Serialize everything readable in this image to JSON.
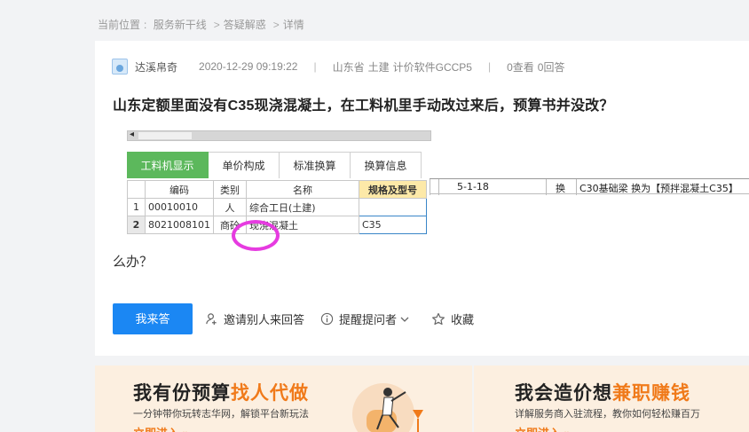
{
  "breadcrumb": {
    "label": "当前位置",
    "colon": ":",
    "items": [
      "服务新干线",
      "答疑解惑",
      "详情"
    ],
    "separator": ">"
  },
  "question": {
    "author": "达溪帛奇",
    "date": "2020-12-29 09:19:22",
    "region": "山东省",
    "category": "土建",
    "software": "计价软件GCCP5",
    "views": "0查看",
    "answers": "0回答",
    "title": "山东定额里面没有C35现浇混凝土，在工料机里手动改过来后，预算书并没改？",
    "body": "么办？"
  },
  "screenshot": {
    "tabs": [
      "工料机显示",
      "单价构成",
      "标准换算",
      "换算信息"
    ],
    "columns": [
      "编码",
      "类别",
      "名称",
      "规格及型号"
    ],
    "rows": [
      {
        "num": "1",
        "code": "00010010",
        "type": "人",
        "name": "综合工日(土建)",
        "spec": ""
      },
      {
        "num": "2",
        "code": "8021008101",
        "type": "商砼",
        "name": "现浇混凝土",
        "spec": "C35"
      }
    ],
    "row2": {
      "code": "5-1-18",
      "type": "换",
      "desc": "C30基础梁  换为【预拌混凝土C35】"
    }
  },
  "actions": {
    "answer_label": "我来答",
    "invite_label": "邀请别人来回答",
    "remind_label": "提醒提问者",
    "collect_label": "收藏"
  },
  "banners": {
    "left": {
      "title_plain": "我有份预算",
      "title_accent": "找人代做",
      "sub": "一分钟带你玩转志华网，解锁平台新玩法",
      "link": "立即进入 »"
    },
    "right": {
      "title_plain": "我会造价想",
      "title_accent": "兼职赚钱",
      "sub": "详解服务商入驻流程，教你如何轻松赚百万",
      "link": "立即进入 »"
    }
  },
  "colors": {
    "primary": "#1b87f3",
    "accent_orange": "#f07a1a",
    "tab_green": "#5cb85c",
    "circle_magenta": "#e63be0"
  }
}
